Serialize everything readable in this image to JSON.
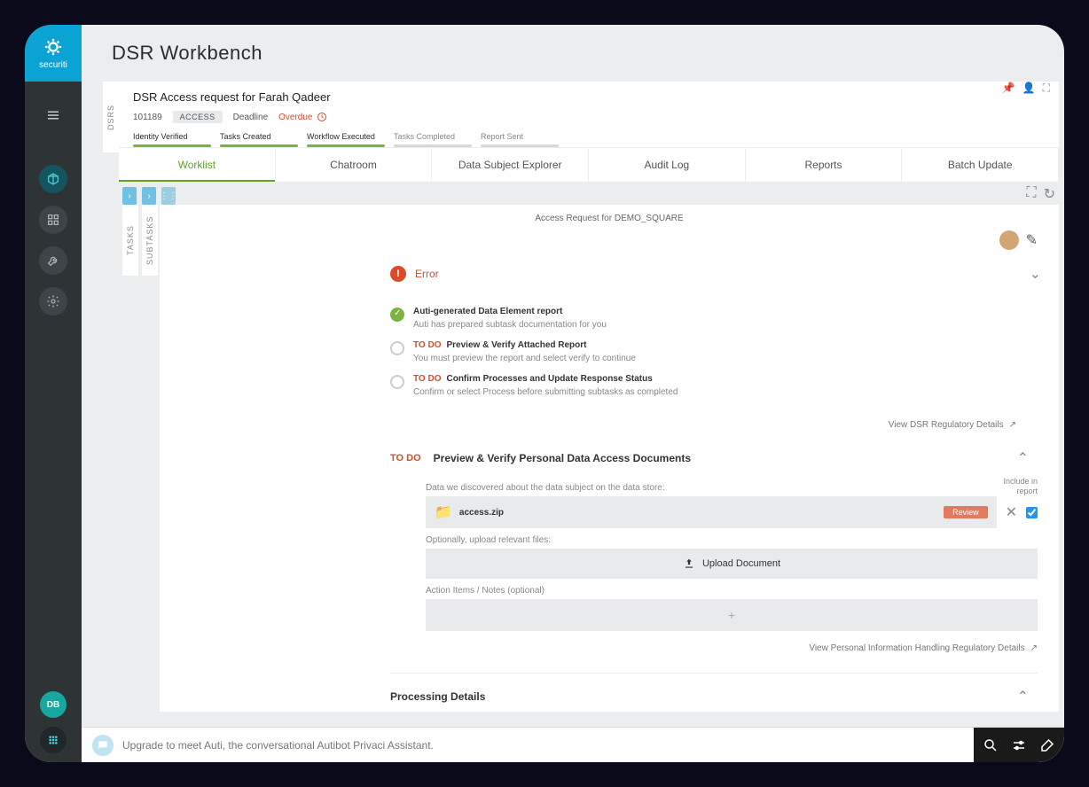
{
  "brand": "securiti",
  "page_title": "DSR Workbench",
  "sidebar": {
    "avatar_initials": "DB"
  },
  "request": {
    "title": "DSR Access request for Farah Qadeer",
    "id": "101189",
    "type_badge": "ACCESS",
    "deadline_label": "Deadline",
    "deadline_status": "Overdue"
  },
  "steps": [
    {
      "label": "Identity Verified",
      "done": true
    },
    {
      "label": "Tasks Created",
      "done": true
    },
    {
      "label": "Workflow Executed",
      "done": true
    },
    {
      "label": "Tasks Completed",
      "done": false
    },
    {
      "label": "Report Sent",
      "done": false
    }
  ],
  "tabs": [
    {
      "label": "Worklist",
      "active": true
    },
    {
      "label": "Chatroom",
      "active": false
    },
    {
      "label": "Data Subject Explorer",
      "active": false
    },
    {
      "label": "Audit Log",
      "active": false
    },
    {
      "label": "Reports",
      "active": false
    },
    {
      "label": "Batch Update",
      "active": false
    }
  ],
  "vert_labels": {
    "outer": "DSRS",
    "tasks": "TASKS",
    "subtasks": "SUBTASKS"
  },
  "workspace": {
    "title": "Access Request for DEMO_SQUARE",
    "error_label": "Error",
    "checklist": [
      {
        "done": true,
        "todo": false,
        "title": "Auti-generated Data Element report",
        "desc": "Auti has prepared subtask documentation for you"
      },
      {
        "done": false,
        "todo": true,
        "title": "Preview & Verify Attached Report",
        "desc": "You must preview the report and select verify to continue"
      },
      {
        "done": false,
        "todo": true,
        "title": "Confirm Processes and Update Response Status",
        "desc": "Confirm or select Process before submitting subtasks as completed"
      }
    ],
    "view_reg_link": "View DSR Regulatory Details",
    "preview_section": {
      "todo_label": "TO DO",
      "title": "Preview & Verify Personal Data Access Documents",
      "discovered_label": "Data we discovered about the data subject on the data store:",
      "include_label": "Include in report",
      "file_name": "access.zip",
      "review_label": "Review",
      "upload_hint_label": "Optionally, upload relevant files:",
      "upload_button": "Upload Document",
      "notes_label": "Action Items / Notes (optional)",
      "notes_placeholder": "+",
      "view_pi_link": "View Personal Information Handling Regulatory Details"
    },
    "processing_section_title": "Processing Details"
  },
  "bottom": {
    "text": "Upgrade to meet Auti, the conversational Autibot Privaci Assistant."
  },
  "todo_word": "TO DO"
}
